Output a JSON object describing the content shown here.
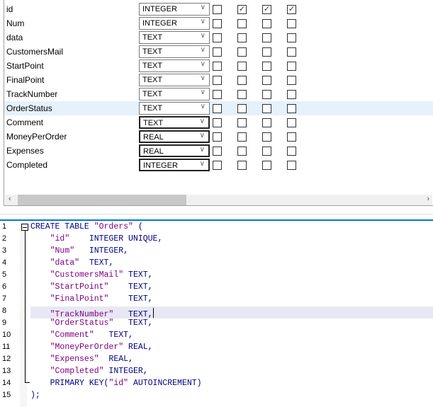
{
  "columns": [
    {
      "name": "id",
      "type": "INTEGER",
      "checks": [
        false,
        true,
        true,
        true
      ]
    },
    {
      "name": "Num",
      "type": "INTEGER",
      "checks": [
        false,
        false,
        false,
        false
      ]
    },
    {
      "name": "data",
      "type": "TEXT",
      "checks": [
        false,
        false,
        false,
        false
      ]
    },
    {
      "name": "CustomersMail",
      "type": "TEXT",
      "checks": [
        false,
        false,
        false,
        false
      ]
    },
    {
      "name": "StartPoint",
      "type": "TEXT",
      "checks": [
        false,
        false,
        false,
        false
      ]
    },
    {
      "name": "FinalPoint",
      "type": "TEXT",
      "checks": [
        false,
        false,
        false,
        false
      ]
    },
    {
      "name": "TrackNumber",
      "type": "TEXT",
      "checks": [
        false,
        false,
        false,
        false
      ]
    },
    {
      "name": "OrderStatus",
      "type": "TEXT",
      "checks": [
        false,
        false,
        false,
        false
      ],
      "selected": true
    },
    {
      "name": "Comment",
      "type": "TEXT",
      "checks": [
        false,
        false,
        false,
        false
      ]
    },
    {
      "name": "MoneyPerOrder",
      "type": "REAL",
      "checks": [
        false,
        false,
        false,
        false
      ]
    },
    {
      "name": "Expenses",
      "type": "REAL",
      "checks": [
        false,
        false,
        false,
        false
      ]
    },
    {
      "name": "Completed",
      "type": "INTEGER",
      "checks": [
        false,
        false,
        false,
        false
      ]
    }
  ],
  "scrollbar": {
    "left_icon": "chevron-left-icon",
    "right_icon": "chevron-right-icon",
    "left": "‹",
    "right": "›"
  },
  "sql_lines": [
    [
      [
        "kw",
        "CREATE TABLE "
      ],
      [
        "st",
        "\"Orders\""
      ],
      [
        "kw",
        " ("
      ]
    ],
    [
      [
        "",
        "    "
      ],
      [
        "st",
        "\"id\""
      ],
      [
        "kw",
        "    INTEGER UNIQUE,"
      ]
    ],
    [
      [
        "",
        "    "
      ],
      [
        "st",
        "\"Num\""
      ],
      [
        "kw",
        "   INTEGER,"
      ]
    ],
    [
      [
        "",
        "    "
      ],
      [
        "st",
        "\"data\""
      ],
      [
        "kw",
        "  TEXT,"
      ]
    ],
    [
      [
        "",
        "    "
      ],
      [
        "st",
        "\"CustomersMail\""
      ],
      [
        "kw",
        " TEXT,"
      ]
    ],
    [
      [
        "",
        "    "
      ],
      [
        "st",
        "\"StartPoint\""
      ],
      [
        "kw",
        "    TEXT,"
      ]
    ],
    [
      [
        "",
        "    "
      ],
      [
        "st",
        "\"FinalPoint\""
      ],
      [
        "kw",
        "    TEXT,"
      ]
    ],
    [
      [
        "",
        "    "
      ],
      [
        "st",
        "\"TrackNumber\""
      ],
      [
        "kw",
        "   TEXT,"
      ]
    ],
    [
      [
        "",
        "    "
      ],
      [
        "st",
        "\"OrderStatus\""
      ],
      [
        "kw",
        "   TEXT,"
      ]
    ],
    [
      [
        "",
        "    "
      ],
      [
        "st",
        "\"Comment\""
      ],
      [
        "kw",
        "   TEXT,"
      ]
    ],
    [
      [
        "",
        "    "
      ],
      [
        "st",
        "\"MoneyPerOrder\""
      ],
      [
        "kw",
        " REAL,"
      ]
    ],
    [
      [
        "",
        "    "
      ],
      [
        "st",
        "\"Expenses\""
      ],
      [
        "kw",
        "  REAL,"
      ]
    ],
    [
      [
        "",
        "    "
      ],
      [
        "st",
        "\"Completed\""
      ],
      [
        "kw",
        " INTEGER,"
      ]
    ],
    [
      [
        "",
        "    "
      ],
      [
        "kw",
        "PRIMARY KEY("
      ],
      [
        "st",
        "\"id\""
      ],
      [
        "kw",
        " AUTOINCREMENT)"
      ]
    ],
    [
      [
        "kw",
        ");"
      ]
    ]
  ],
  "current_line": 8,
  "colors": {
    "keyword": "#000080",
    "string": "#800080",
    "accent": "#0078d7",
    "selected_row": "#e5f1fb"
  }
}
